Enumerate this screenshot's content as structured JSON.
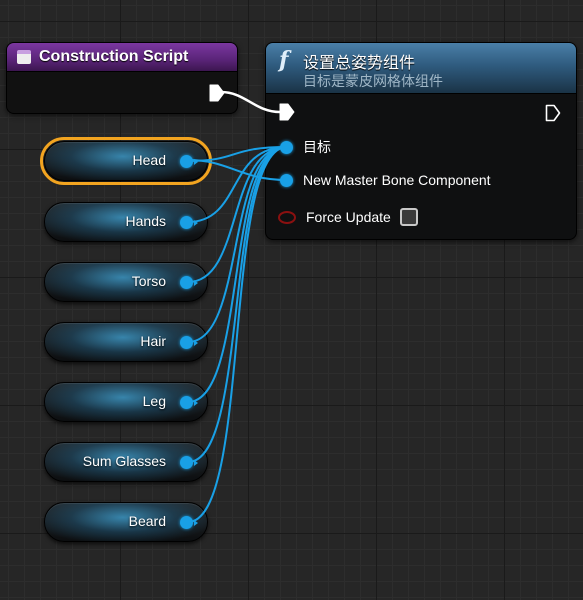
{
  "construction_script": {
    "title": "Construction Script"
  },
  "function_node": {
    "icon": "function-f-icon",
    "title": "设置总姿势组件",
    "subtitle": "目标是蒙皮网格体组件",
    "pins": {
      "target_label": "目标",
      "master_bone_label": "New Master Bone Component",
      "force_update_label": "Force Update",
      "force_update_checked": false
    }
  },
  "variables": [
    {
      "label": "Head",
      "selected": true
    },
    {
      "label": "Hands",
      "selected": false
    },
    {
      "label": "Torso",
      "selected": false
    },
    {
      "label": "Hair",
      "selected": false
    },
    {
      "label": "Leg",
      "selected": false
    },
    {
      "label": "Sum Glasses",
      "selected": false
    },
    {
      "label": "Beard",
      "selected": false
    }
  ],
  "colors": {
    "object_pin": "#19a0e6",
    "exec_pin": "#ffffff",
    "selection": "#f2a420",
    "construction_header": "#5a2478",
    "function_header": "#2f5b7e",
    "boolean_pin": "#8a1010"
  }
}
